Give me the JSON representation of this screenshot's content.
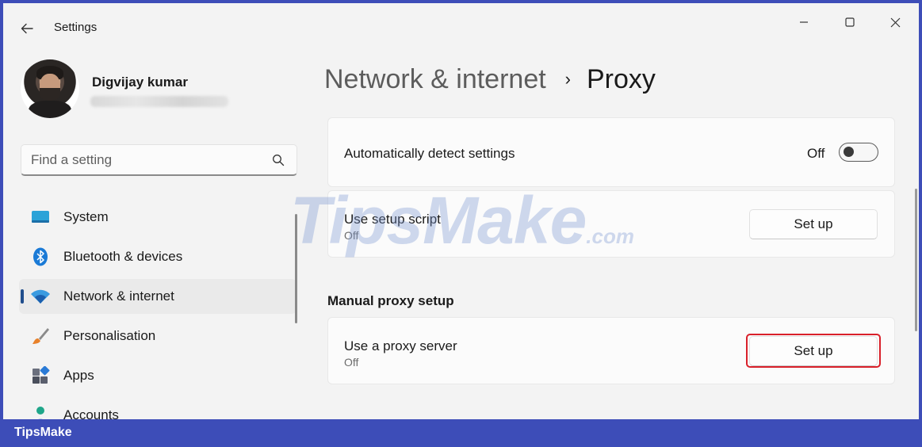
{
  "window": {
    "title": "Settings"
  },
  "profile": {
    "name": "Digvijay kumar"
  },
  "search": {
    "placeholder": "Find a setting"
  },
  "sidebar": {
    "items": [
      {
        "label": "System",
        "icon": "monitor-icon",
        "active": false
      },
      {
        "label": "Bluetooth & devices",
        "icon": "bluetooth-icon",
        "active": false
      },
      {
        "label": "Network & internet",
        "icon": "wifi-icon",
        "active": true
      },
      {
        "label": "Personalisation",
        "icon": "brush-icon",
        "active": false
      },
      {
        "label": "Apps",
        "icon": "apps-icon",
        "active": false
      },
      {
        "label": "Accounts",
        "icon": "person-icon",
        "active": false
      }
    ]
  },
  "breadcrumb": {
    "parent": "Network & internet",
    "separator": "›",
    "current": "Proxy"
  },
  "auto_detect": {
    "title": "Automatically detect settings",
    "state_label": "Off",
    "enabled": false
  },
  "setup_script": {
    "title": "Use setup script",
    "status": "Off",
    "button": "Set up"
  },
  "manual": {
    "heading": "Manual proxy setup",
    "title": "Use a proxy server",
    "status": "Off",
    "button": "Set up"
  },
  "watermark": {
    "text": "TipsMake",
    "domain": ".com"
  },
  "footer": {
    "brand": "TipsMake"
  },
  "colors": {
    "accent": "#1f4d8c",
    "highlight": "#d9202a",
    "frame_border": "#3d4db8"
  }
}
